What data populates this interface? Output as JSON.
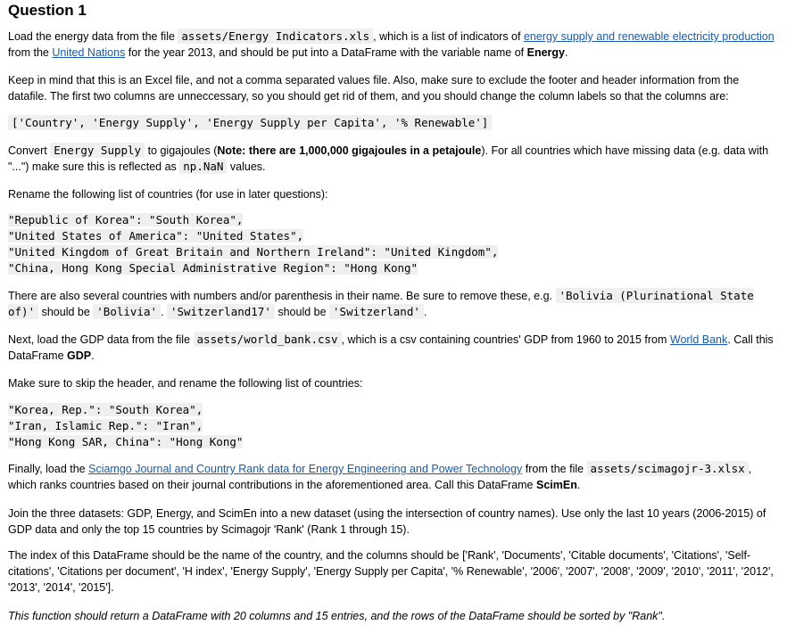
{
  "heading": "Question 1",
  "p1": {
    "t1": "Load the energy data from the file ",
    "code1": "assets/Energy Indicators.xls",
    "t2": ", which is a list of indicators of ",
    "link1": "energy supply and renewable electricity production",
    "t3": " from the ",
    "link2": "United Nations",
    "t4": " for the year 2013, and should be put into a DataFrame with the variable name of ",
    "b1": "Energy",
    "t5": "."
  },
  "p2": {
    "t1": "Keep in mind that this is an Excel file, and not a comma separated values file. Also, make sure to exclude the footer and header information from the datafile. The first two columns are unneccessary, so you should get rid of them, and you should change the column labels so that the columns are:"
  },
  "code_columns": "['Country', 'Energy Supply', 'Energy Supply per Capita', '% Renewable']",
  "p3": {
    "t1": "Convert ",
    "code1": "Energy Supply",
    "t2": " to gigajoules (",
    "b1": "Note: there are 1,000,000 gigajoules in a petajoule",
    "t3": "). For all countries which have missing data (e.g. data with \"...\") make sure this is reflected as ",
    "code2": "np.NaN",
    "t4": " values."
  },
  "p4": {
    "t1": "Rename the following list of countries (for use in later questions):"
  },
  "rename_energy": [
    "\"Republic of Korea\": \"South Korea\",",
    "\"United States of America\": \"United States\",",
    "\"United Kingdom of Great Britain and Northern Ireland\": \"United Kingdom\",",
    "\"China, Hong Kong Special Administrative Region\": \"Hong Kong\""
  ],
  "p5": {
    "t1": "There are also several countries with numbers and/or parenthesis in their name. Be sure to remove these, e.g. ",
    "code1": "'Bolivia (Plurinational State of)'",
    "t2": " should be ",
    "code2": "'Bolivia'",
    "t3": ". ",
    "code3": "'Switzerland17'",
    "t4": " should be ",
    "code4": "'Switzerland'",
    "t5": "."
  },
  "p6": {
    "t1": "Next, load the GDP data from the file ",
    "code1": "assets/world_bank.csv",
    "t2": ", which is a csv containing countries' GDP from 1960 to 2015 from ",
    "link1": "World Bank",
    "t3": ". Call this DataFrame ",
    "b1": "GDP",
    "t4": "."
  },
  "p7": {
    "t1": "Make sure to skip the header, and rename the following list of countries:"
  },
  "rename_gdp": [
    "\"Korea, Rep.\": \"South Korea\",",
    "\"Iran, Islamic Rep.\": \"Iran\",",
    "\"Hong Kong SAR, China\": \"Hong Kong\""
  ],
  "p8": {
    "t1": "Finally, load the ",
    "link1": "Sciamgo Journal and Country Rank data for Energy Engineering and Power Technology",
    "t2": " from the file ",
    "code1": "assets/scimagojr-3.xlsx",
    "t3": ", which ranks countries based on their journal contributions in the aforementioned area. Call this DataFrame ",
    "b1": "ScimEn",
    "t4": "."
  },
  "p9": {
    "t1": "Join the three datasets: GDP, Energy, and ScimEn into a new dataset (using the intersection of country names). Use only the last 10 years (2006-2015) of GDP data and only the top 15 countries by Scimagojr 'Rank' (Rank 1 through 15)."
  },
  "p10": {
    "t1": "The index of this DataFrame should be the name of the country, and the columns should be ['Rank', 'Documents', 'Citable documents', 'Citations', 'Self-citations', 'Citations per document', 'H index', 'Energy Supply', 'Energy Supply per Capita', '% Renewable', '2006', '2007', '2008', '2009', '2010', '2011', '2012', '2013', '2014', '2015']."
  },
  "p11": {
    "t1": "This function should return a DataFrame with 20 columns and 15 entries, and the rows of the DataFrame should be sorted by \"Rank\"."
  }
}
